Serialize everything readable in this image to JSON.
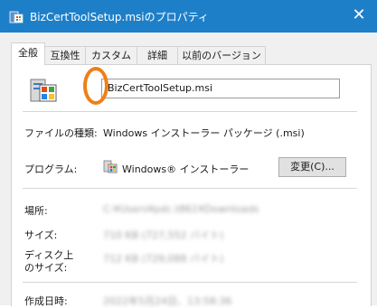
{
  "window": {
    "title": "BizCertToolSetup.msiのプロパティ",
    "close_glyph": "✕"
  },
  "tabs": [
    {
      "label": "全般",
      "active": true
    },
    {
      "label": "互換性",
      "active": false
    },
    {
      "label": "カスタム",
      "active": false
    },
    {
      "label": "詳細",
      "active": false
    },
    {
      "label": "以前のバージョン",
      "active": false
    }
  ],
  "general": {
    "filename": "BizCertToolSetup.msi",
    "file_type_label": "ファイルの種類:",
    "file_type_value": "Windows インストーラー パッケージ (.msi)",
    "program_label": "プログラム:",
    "program_value": "Windows® インストーラー",
    "change_button": "変更(C)...",
    "location_label": "場所:",
    "location_value": "C:¥Users¥pdc.t861¥Downloads",
    "size_label": "サイズ:",
    "size_value": "710 KB (727,552 バイト)",
    "disk_size_label_line1": "ディスク上",
    "disk_size_label_line2": "のサイズ:",
    "disk_size_value": "712 KB (729,088 バイト)",
    "created_label": "作成日時:",
    "created_value": "2022年5月24日、13:58:36"
  },
  "colors": {
    "titlebar": "#1e7fc9",
    "highlight_ring": "#f07f17"
  },
  "icons": {
    "title": "msi-package-icon",
    "file": "msi-package-icon",
    "program": "windows-installer-icon",
    "close": "close-icon"
  }
}
